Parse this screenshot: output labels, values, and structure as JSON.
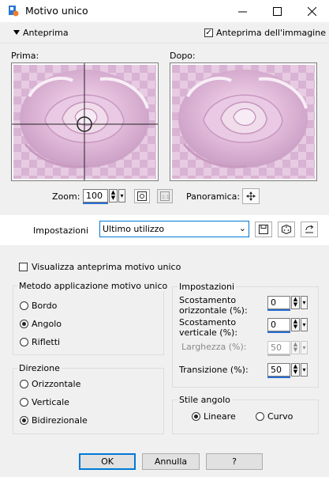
{
  "window": {
    "title": "Motivo unico"
  },
  "toolbar": {
    "collapse_label": "Anteprima",
    "preview_image_label": "Anteprima dell'immagine",
    "preview_image_checked": true
  },
  "previews": {
    "before_label": "Prima:",
    "after_label": "Dopo:"
  },
  "zoom": {
    "label": "Zoom:",
    "value": "100",
    "pan_label": "Panoramica:"
  },
  "presets": {
    "label": "Impostazioni",
    "value": "Ultimo utilizzo"
  },
  "options": {
    "show_preview_label": "Visualizza anteprima motivo unico",
    "show_preview_checked": false
  },
  "method": {
    "title": "Metodo applicazione motivo unico",
    "options": [
      "Bordo",
      "Angolo",
      "Rifletti"
    ],
    "selected": "Angolo"
  },
  "direction": {
    "title": "Direzione",
    "options": [
      "Orizzontale",
      "Verticale",
      "Bidirezionale"
    ],
    "selected": "Bidirezionale"
  },
  "settings": {
    "title": "Impostazioni",
    "h_offset_label": "Scostamento orizzontale (%):",
    "h_offset_value": "0",
    "v_offset_label": "Scostamento verticale (%):",
    "v_offset_value": "0",
    "width_label": "Larghezza (%):",
    "width_value": "50",
    "transition_label": "Transizione (%):",
    "transition_value": "50"
  },
  "corner_style": {
    "title": "Stile angolo",
    "options": [
      "Lineare",
      "Curvo"
    ],
    "selected": "Lineare"
  },
  "buttons": {
    "ok": "OK",
    "cancel": "Annulla",
    "help": "?"
  },
  "colors": {
    "accent": "#2a6fd3",
    "rose": "#e2b8da"
  }
}
